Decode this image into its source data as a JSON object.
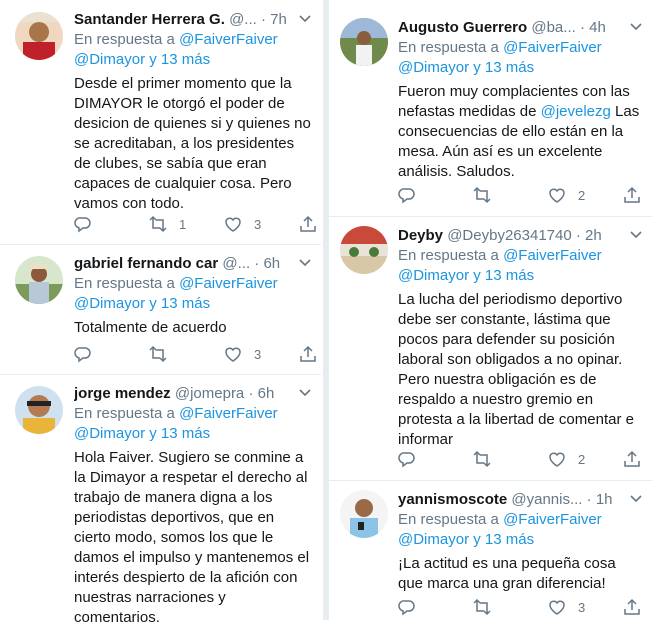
{
  "reply_prefix": "En respuesta a",
  "tweets": [
    {
      "name": "Santander Herrera G.",
      "handle": "@...",
      "dot": "·",
      "time": "7h",
      "reply_to_1": "@FaiverFaiver",
      "reply_to_2": "@Dimayor y 13 más",
      "text": "Desde el primer momento que la DIMAYOR le otorgó el poder de desicion de quienes si y quienes no se acreditaban,  a los presidentes de clubes, se sabía que eran capaces de cualquier cosa. Pero vamos con todo.",
      "retweets": "1",
      "likes": "3"
    },
    {
      "name": "gabriel fernando car",
      "handle": "@...",
      "dot": "·",
      "time": "6h",
      "reply_to_1": "@FaiverFaiver",
      "reply_to_2": "@Dimayor y 13 más",
      "text": "Totalmente de acuerdo",
      "retweets": "",
      "likes": "3"
    },
    {
      "name": "jorge mendez",
      "handle": "@jomepra",
      "dot": "·",
      "time": "6h",
      "reply_to_1": "@FaiverFaiver",
      "reply_to_2": "@Dimayor y 13 más",
      "text": "Hola Faiver. Sugiero se conmine a la Dimayor a respetar el derecho al trabajo de manera digna a los periodistas deportivos, que en cierto modo, somos los que le damos el impulso y mantenemos el interés despierto de la afición con nuestras narraciones y comentarios.",
      "retweets": "",
      "likes": ""
    },
    {
      "name": "Augusto Guerrero",
      "handle": "@ba...",
      "dot": "·",
      "time": "4h",
      "reply_to_1": "@FaiverFaiver",
      "reply_to_2": "@Dimayor y 13 más",
      "text_before": "Fueron muy complacientes con las nefastas medidas de ",
      "mention": "@jevelezg",
      "text_after": " Las consecuencias de ello están en la mesa. Aún así es un excelente análisis. Saludos.",
      "retweets": "",
      "likes": "2"
    },
    {
      "name": "Deyby",
      "handle": "@Deyby26341740",
      "dot": "·",
      "time": "2h",
      "reply_to_1": "@FaiverFaiver",
      "reply_to_2": "@Dimayor y 13 más",
      "text": "La lucha del periodismo deportivo debe ser constante, lástima que pocos para defender su posición laboral son obligados a no opinar. Pero nuestra obligación es de respaldo a nuestro gremio en protesta a la libertad de comentar e informar",
      "retweets": "",
      "likes": "2"
    },
    {
      "name": "yannismoscote",
      "handle": "@yannis...",
      "dot": "·",
      "time": "1h",
      "reply_to_1": "@FaiverFaiver",
      "reply_to_2": "@Dimayor y 13 más",
      "text": "¡La actitud es una pequeña cosa que marca una gran diferencia!",
      "retweets": "",
      "likes": "3"
    }
  ],
  "colors": {
    "link": "#1b95e0",
    "meta": "#657786",
    "text": "#14171a",
    "divider": "#e6ecf0"
  },
  "icons": [
    "reply-icon",
    "retweet-icon",
    "like-icon",
    "share-icon",
    "caret-down-icon"
  ]
}
